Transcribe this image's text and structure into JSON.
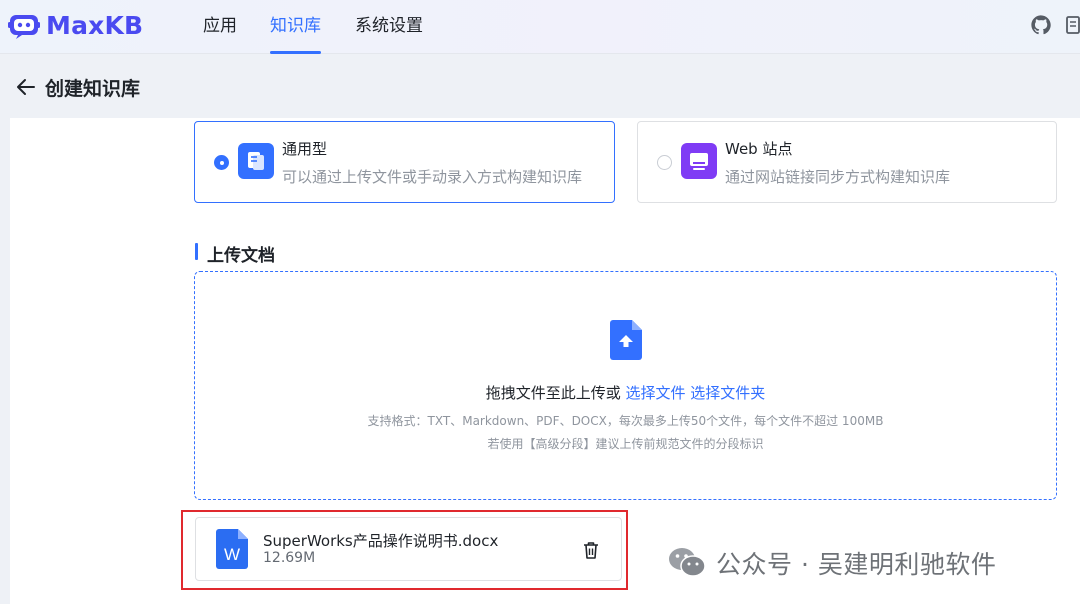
{
  "app": {
    "name": "MaxKB"
  },
  "nav": [
    {
      "label": "应用",
      "active": false
    },
    {
      "label": "知识库",
      "active": true
    },
    {
      "label": "系统设置",
      "active": false
    }
  ],
  "header_icons": [
    "github-icon",
    "doc-icon"
  ],
  "page": {
    "title": "创建知识库"
  },
  "types": [
    {
      "title": "通用型",
      "desc": "可以通过上传文件或手动录入方式构建知识库",
      "selected": true,
      "icon": "doc-stack-icon",
      "color": "#3370ff"
    },
    {
      "title": "Web 站点",
      "desc": "通过网站链接同步方式构建知识库",
      "selected": false,
      "icon": "monitor-icon",
      "color": "#7f3bf5"
    }
  ],
  "upload": {
    "section_title": "上传文档",
    "main_text": "拖拽文件至此上传或",
    "select_file": "选择文件",
    "select_folder": "选择文件夹",
    "hint1": "支持格式：TXT、Markdown、PDF、DOCX，每次最多上传50个文件，每个文件不超过 100MB",
    "hint2": "若使用【高级分段】建议上传前规范文件的分段标识"
  },
  "file": {
    "name": "SuperWorks产品操作说明书.docx",
    "size": "12.69M",
    "icon_letter": "W"
  },
  "watermark": {
    "text": "公众号 · 吴建明利驰软件"
  },
  "colors": {
    "primary": "#3370ff",
    "brand": "#4a4af0",
    "highlight": "#e0292e",
    "web_icon": "#7f3bf5"
  }
}
